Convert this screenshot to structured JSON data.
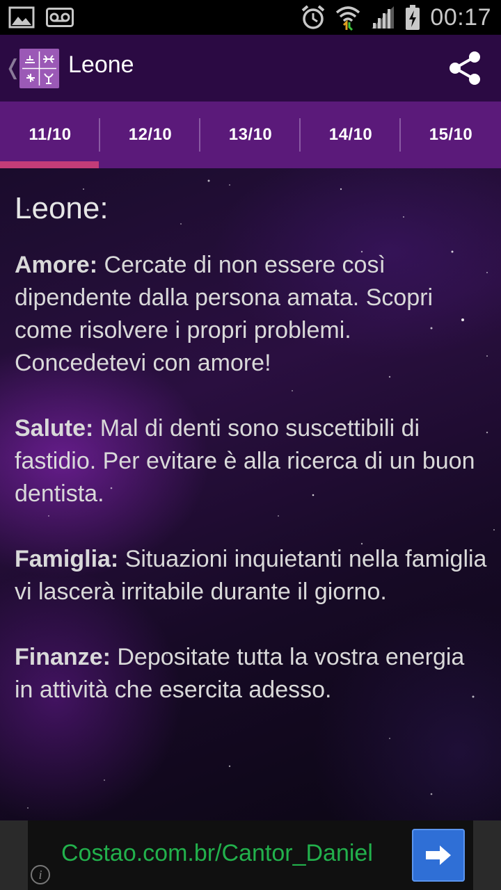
{
  "status_bar": {
    "time": "00:17",
    "left_icons": [
      "gallery-notification-icon",
      "voicemail-icon"
    ],
    "right_icons": [
      "alarm-icon",
      "wifi-icon",
      "signal-icon",
      "battery-charging-icon"
    ]
  },
  "action_bar": {
    "title": "Leone",
    "logo_icon": "zodiac-signs-icon",
    "share_icon": "share-icon"
  },
  "tabs": [
    {
      "label": "11/10",
      "selected": true
    },
    {
      "label": "12/10",
      "selected": false
    },
    {
      "label": "13/10",
      "selected": false
    },
    {
      "label": "14/10",
      "selected": false
    },
    {
      "label": "15/10",
      "selected": false
    }
  ],
  "horoscope": {
    "heading": "Leone:",
    "sections": [
      {
        "label": "Amore:",
        "text": " Cercate di non essere così dipendente dalla persona amata. Scopri come risolvere i propri problemi. Concedetevi con amore!"
      },
      {
        "label": "Salute:",
        "text": " Mal di denti sono suscettibili di fastidio. Per evitare è alla ricerca di un buon dentista."
      },
      {
        "label": "Famiglia:",
        "text": " Situazioni inquietanti nella famiglia vi lascerà irritabile durante il giorno."
      },
      {
        "label": "Finanze:",
        "text": " Depositate tutta la vostra energia in attività che esercita adesso."
      }
    ]
  },
  "ad": {
    "url_text": "Costao.com.br/Cantor_Daniel",
    "arrow_icon": "arrow-right-icon",
    "info_icon": "info-icon",
    "info_glyph": "i"
  },
  "colors": {
    "action_bar": "#2b0a43",
    "tabs": "#5b1a7a",
    "tab_indicator": "#c33c78",
    "ad_url": "#22b14c",
    "ad_button": "#2f6fd6"
  }
}
